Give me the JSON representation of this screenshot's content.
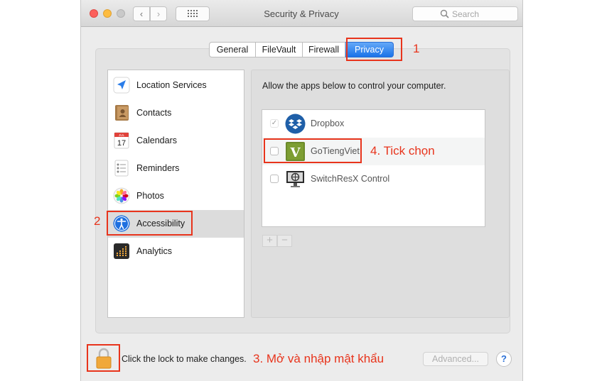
{
  "window": {
    "title": "Security & Privacy"
  },
  "toolbar": {
    "back_icon": "‹",
    "forward_icon": "›"
  },
  "search": {
    "placeholder": "Search"
  },
  "tabs": [
    {
      "label": "General"
    },
    {
      "label": "FileVault"
    },
    {
      "label": "Firewall"
    },
    {
      "label": "Privacy",
      "selected": true
    }
  ],
  "sidebar": {
    "items": [
      {
        "label": "Location Services",
        "icon": "location-arrow-icon"
      },
      {
        "label": "Contacts",
        "icon": "contacts-book-icon"
      },
      {
        "label": "Calendars",
        "icon": "calendar-icon",
        "icon_month": "JUL",
        "icon_day": "17"
      },
      {
        "label": "Reminders",
        "icon": "reminders-list-icon"
      },
      {
        "label": "Photos",
        "icon": "photos-flower-icon"
      },
      {
        "label": "Accessibility",
        "icon": "accessibility-person-icon",
        "selected": true
      },
      {
        "label": "Analytics",
        "icon": "analytics-grid-icon"
      }
    ]
  },
  "main": {
    "description": "Allow the apps below to control your computer.",
    "apps": [
      {
        "name": "Dropbox",
        "checked": true,
        "icon": "dropbox-icon"
      },
      {
        "name": "GoTiengViet",
        "checked": false,
        "icon": "gotiengviet-icon",
        "icon_letter": "V"
      },
      {
        "name": "SwitchResX Control",
        "checked": false,
        "icon": "switchresx-monitor-icon"
      }
    ],
    "add_label": "+",
    "remove_label": "−",
    "check_mark": "✓"
  },
  "footer": {
    "lock_text": "Click the lock to make changes.",
    "advanced_label": "Advanced...",
    "help_label": "?"
  },
  "annotations": {
    "a1": "1",
    "a2": "2",
    "a3": "3. Mở và nhập mật khẩu",
    "a4": "4. Tick chọn"
  },
  "colors": {
    "accent": "#1a73e8",
    "annotation_red": "#e8341c",
    "lock_orange": "#f0a83a"
  }
}
